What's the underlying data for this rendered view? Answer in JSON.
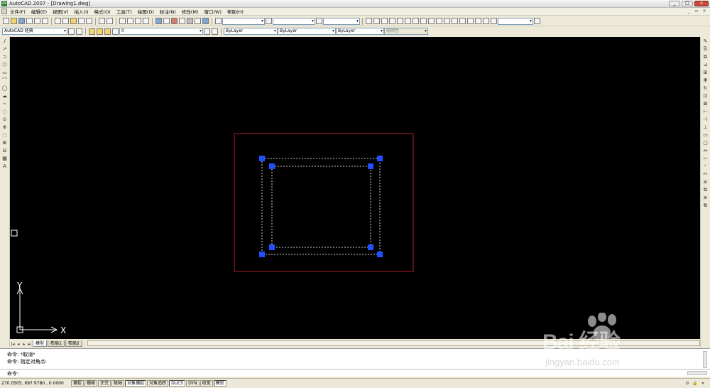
{
  "window": {
    "title": "AutoCAD 2007 - [Drawing1.dwg]",
    "app_icon_label": "2k",
    "controls": {
      "minimize": "_",
      "maximize": "□",
      "close": "×"
    },
    "doc_controls": {
      "minimize": "_",
      "restore": "▫",
      "close": "×"
    }
  },
  "menu": {
    "items": [
      "文件(F)",
      "编辑(E)",
      "视图(V)",
      "插入(I)",
      "格式(O)",
      "工具(T)",
      "绘图(D)",
      "标注(N)",
      "修改(M)",
      "窗口(W)",
      "帮助(H)"
    ]
  },
  "toolbar2": {
    "workspace": "AutoCAD 经典",
    "layer": "0",
    "color": "ByLayer",
    "linetype": "ByLayer",
    "lineweight": "ByLayer",
    "plotstyle": "随颜色"
  },
  "left_tools": [
    "/",
    "↗",
    "⊃",
    "⬠",
    "▭",
    "⌒",
    "◯",
    "☁",
    "∼",
    "◌",
    "⊙",
    "⊕",
    "⬚",
    "⊞",
    "⊟",
    "▦",
    "A"
  ],
  "right_tools": [
    "✎",
    "⎘",
    "⧉",
    "⊿",
    "⊞",
    "✥",
    "↻",
    "⊡",
    "⊠",
    "⊢",
    "⊣",
    "⊥",
    "▭",
    "▢",
    "↔",
    "⌐",
    "◜",
    "✂",
    "⧈",
    "⧉",
    "⧈",
    "⧉"
  ],
  "ucs": {
    "x_label": "X",
    "y_label": "Y"
  },
  "tabs": {
    "nav": [
      "|◂",
      "◂",
      "▸",
      "▸|"
    ],
    "items": [
      "模型",
      "布局1",
      "布局2"
    ],
    "active": "模型"
  },
  "command": {
    "line1": "命令: *取消*",
    "line2": "命令: 指定对角点:",
    "prompt": "命令:"
  },
  "status": {
    "coords": "270.0505, 697.9780 , 0.0000",
    "buttons": [
      {
        "label": "捕捉",
        "on": false
      },
      {
        "label": "栅格",
        "on": false
      },
      {
        "label": "正交",
        "on": false
      },
      {
        "label": "极轴",
        "on": false
      },
      {
        "label": "对象捕捉",
        "on": true
      },
      {
        "label": "对象追踪",
        "on": false
      },
      {
        "label": "DUCS",
        "on": true
      },
      {
        "label": "DYN",
        "on": false
      },
      {
        "label": "线宽",
        "on": false
      },
      {
        "label": "模型",
        "on": true
      }
    ],
    "tray": [
      "⚙",
      "🔒",
      "▾"
    ]
  },
  "watermark": {
    "text": "Bai 经验",
    "url": "jingyan.baidu.com"
  },
  "colors": {
    "canvas": "#000000",
    "red_rect": "#b02030",
    "grip": "#1f4fff",
    "dashed": "#d0d0d0"
  }
}
